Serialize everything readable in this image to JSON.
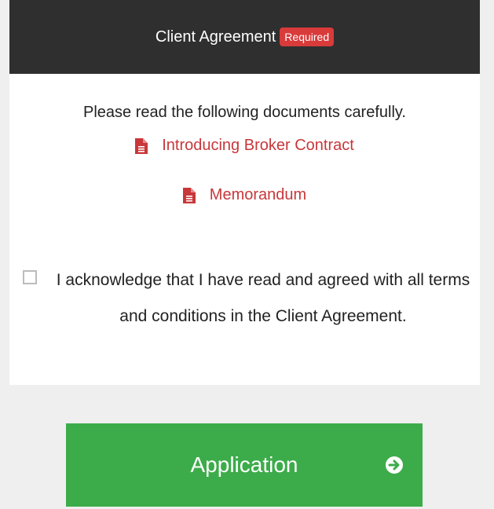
{
  "header": {
    "title": "Client Agreement",
    "badge": "Required"
  },
  "intro_text": "Please read the following documents carefully.",
  "documents": [
    {
      "label": "Introducing Broker Contract",
      "icon": "pdf-file-icon"
    },
    {
      "label": "Memorandum",
      "icon": "pdf-file-icon"
    }
  ],
  "acknowledgement": {
    "text": "I acknowledge that I have read and agreed with all terms and conditions in the Client Agreement.",
    "checked": false
  },
  "apply_button": {
    "label": "Application",
    "icon": "arrow-circle-right-icon"
  },
  "colors": {
    "header_bg": "#2f2f2f",
    "badge_bg": "#d93a3a",
    "link": "#c8373a",
    "button_bg": "#3cac4a",
    "page_bg": "#efefef"
  }
}
